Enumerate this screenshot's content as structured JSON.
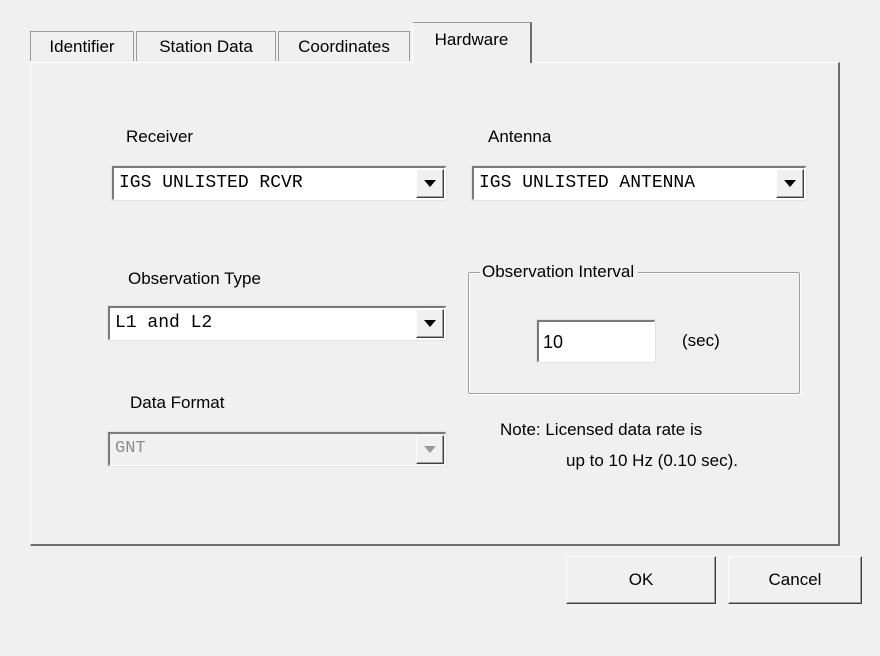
{
  "tabs": [
    {
      "label": "Identifier",
      "active": false
    },
    {
      "label": "Station Data",
      "active": false
    },
    {
      "label": "Coordinates",
      "active": false
    },
    {
      "label": "Hardware",
      "active": true
    }
  ],
  "receiver": {
    "label": "Receiver",
    "value": "IGS UNLISTED RCVR"
  },
  "antenna": {
    "label": "Antenna",
    "value": "IGS UNLISTED ANTENNA"
  },
  "observation_type": {
    "label": "Observation Type",
    "value": "L1 and L2"
  },
  "data_format": {
    "label": "Data Format",
    "value": "GNT",
    "disabled": true
  },
  "observation_interval": {
    "title": "Observation Interval",
    "value": "10",
    "unit": "(sec)"
  },
  "note": {
    "line1": "Note:  Licensed data rate is",
    "line2": "up to 10 Hz (0.10 sec)."
  },
  "buttons": {
    "ok": "OK",
    "cancel": "Cancel"
  },
  "icons": {
    "dropdown": "chevron-down-icon"
  }
}
